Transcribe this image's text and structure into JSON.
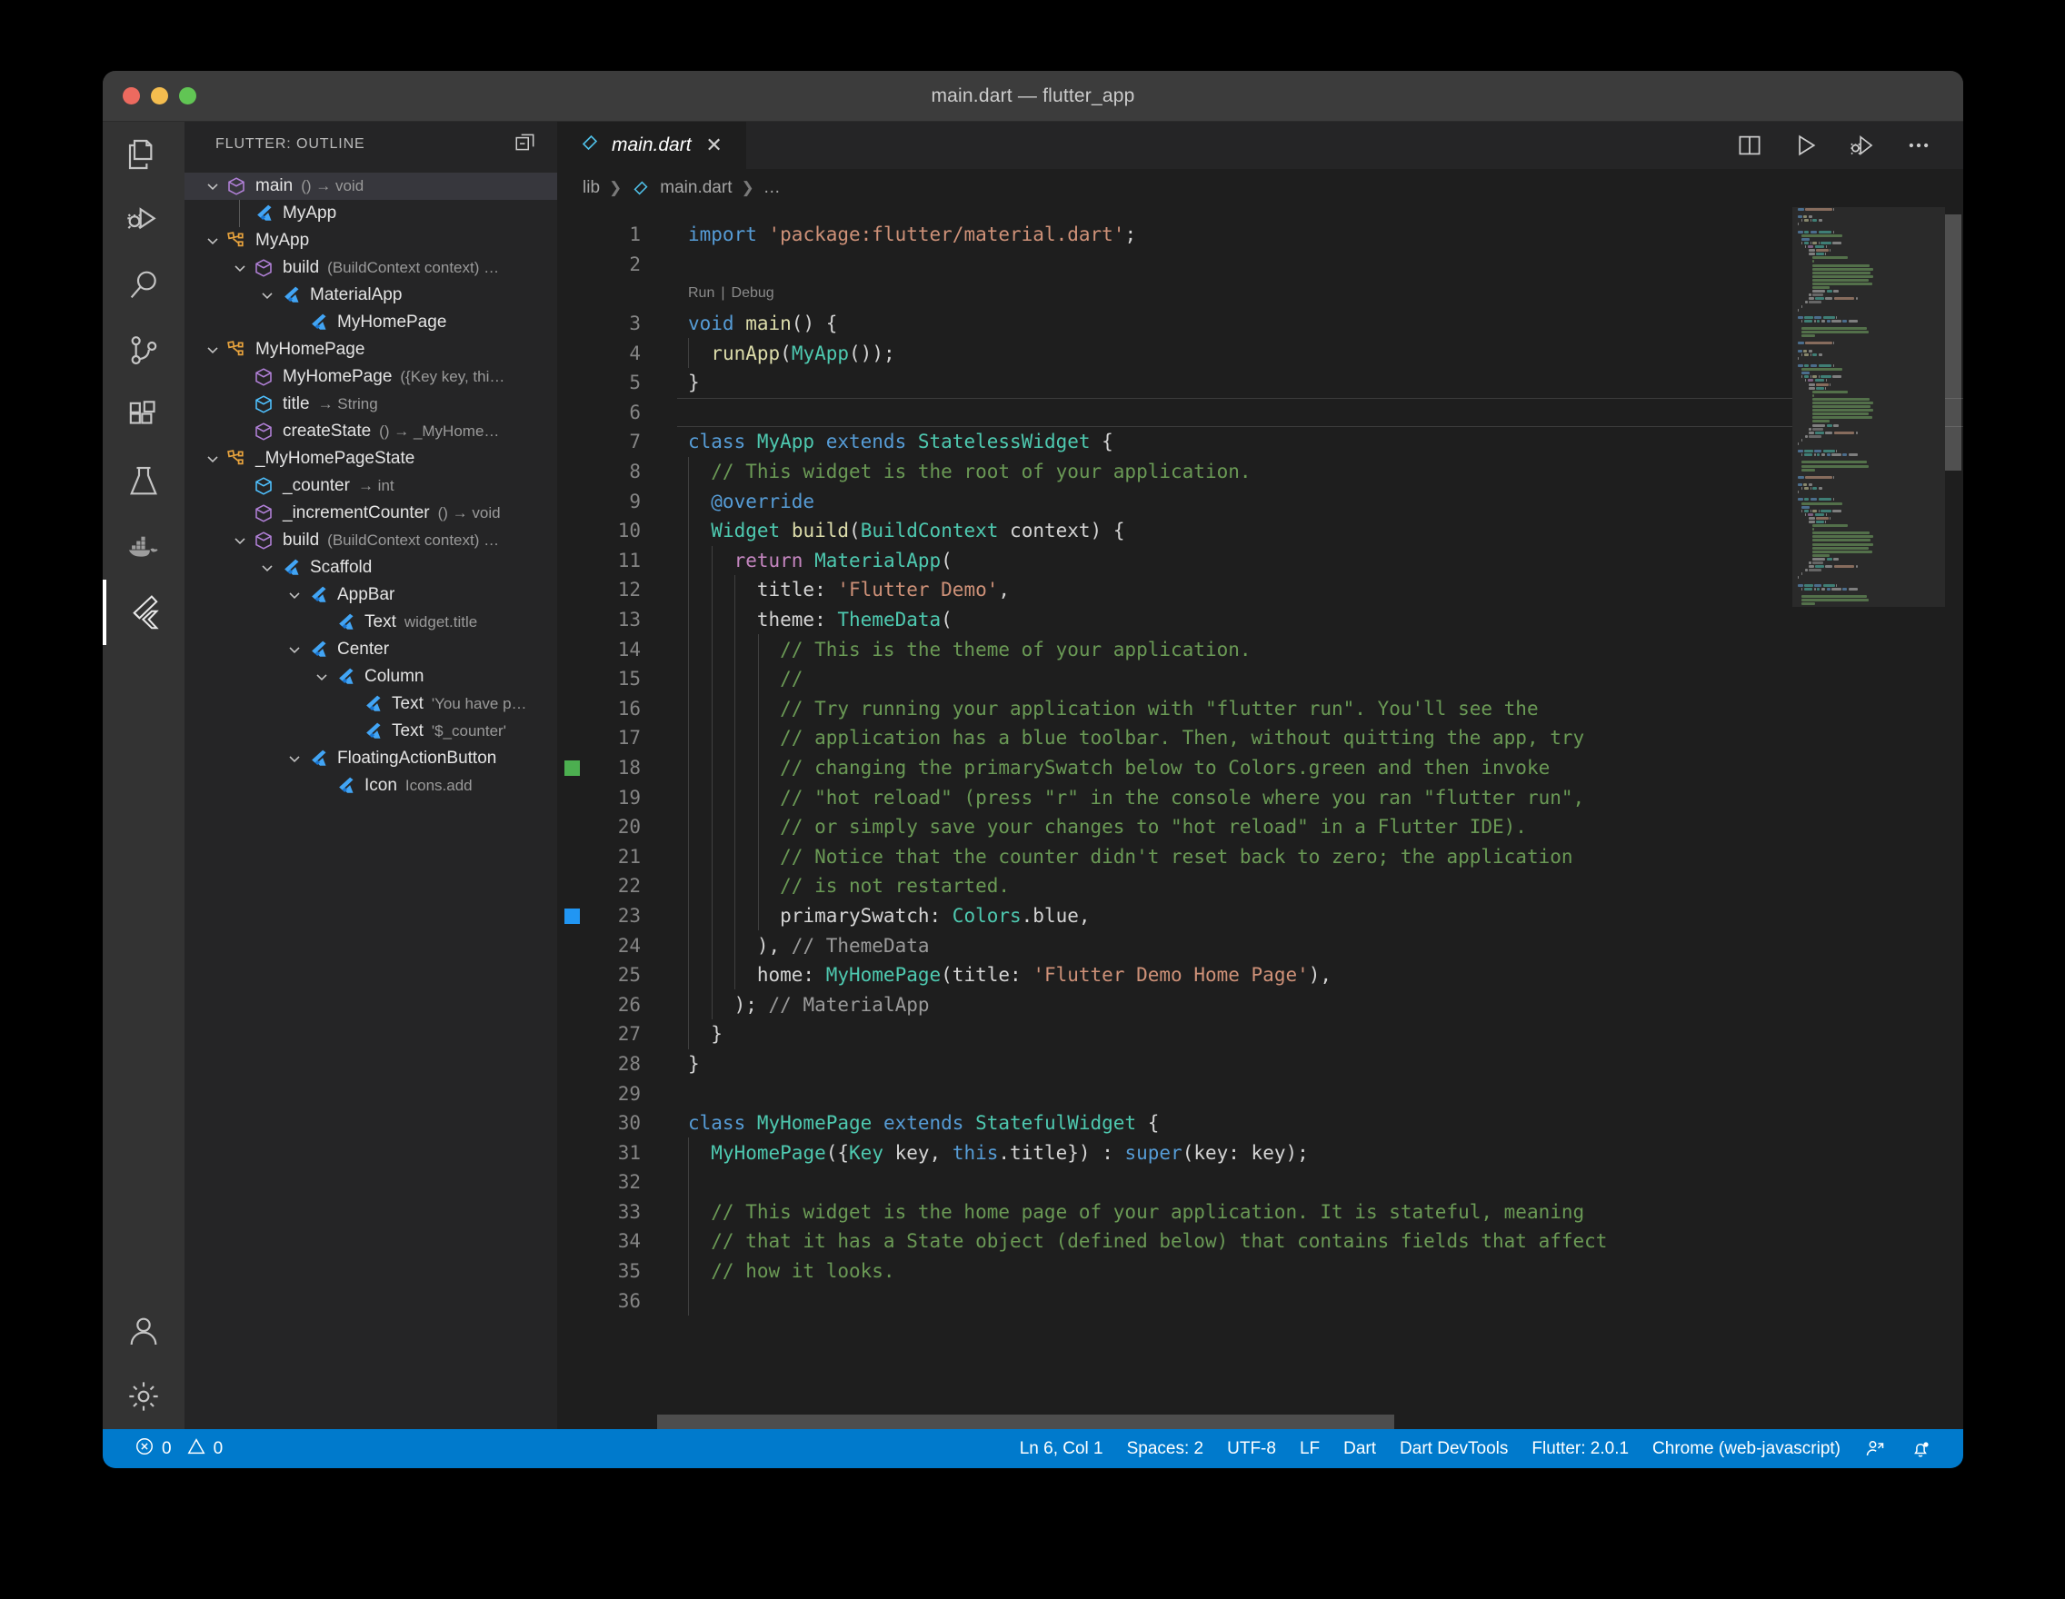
{
  "window": {
    "title": "main.dart — flutter_app",
    "traffic_lights": [
      "close",
      "minimize",
      "maximize"
    ]
  },
  "activity_bar": {
    "items": [
      {
        "name": "explorer",
        "icon": "files-icon",
        "active": false
      },
      {
        "name": "run-and-debug",
        "icon": "debug-play-icon",
        "active": false
      },
      {
        "name": "search",
        "icon": "search-icon",
        "active": false
      },
      {
        "name": "source-control",
        "icon": "source-control-icon",
        "active": false
      },
      {
        "name": "extensions",
        "icon": "extensions-icon",
        "active": false
      },
      {
        "name": "testing",
        "icon": "beaker-icon",
        "active": false
      },
      {
        "name": "docker",
        "icon": "docker-whale-icon",
        "active": false
      },
      {
        "name": "flutter",
        "icon": "flutter-icon",
        "active": true
      }
    ],
    "bottom_items": [
      {
        "name": "accounts",
        "icon": "account-icon"
      },
      {
        "name": "settings",
        "icon": "gear-icon"
      }
    ]
  },
  "sidebar": {
    "title": "FLUTTER: OUTLINE",
    "actions": [
      {
        "name": "collapse-all",
        "icon": "collapse-all-icon"
      }
    ],
    "tree": [
      {
        "indent": 0,
        "twist": "down",
        "icon": "method-cube",
        "label": "main",
        "detail": "() → void",
        "selected": true
      },
      {
        "indent": 1,
        "twist": "none",
        "icon": "flutter",
        "label": "MyApp",
        "detail": "",
        "selected": false
      },
      {
        "indent": 0,
        "twist": "down",
        "icon": "class-orange",
        "label": "MyApp",
        "detail": "",
        "selected": false
      },
      {
        "indent": 1,
        "twist": "down",
        "icon": "method-cube",
        "label": "build",
        "detail": "(BuildContext context) …",
        "selected": false
      },
      {
        "indent": 2,
        "twist": "down",
        "icon": "flutter",
        "label": "MaterialApp",
        "detail": "",
        "selected": false
      },
      {
        "indent": 3,
        "twist": "none",
        "icon": "flutter",
        "label": "MyHomePage",
        "detail": "",
        "selected": false
      },
      {
        "indent": 0,
        "twist": "down",
        "icon": "class-orange",
        "label": "MyHomePage",
        "detail": "",
        "selected": false
      },
      {
        "indent": 1,
        "twist": "none",
        "icon": "method-cube",
        "label": "MyHomePage",
        "detail": "({Key key, thi…",
        "selected": false
      },
      {
        "indent": 1,
        "twist": "none",
        "icon": "field-blue",
        "label": "title",
        "detail": "→ String",
        "selected": false
      },
      {
        "indent": 1,
        "twist": "none",
        "icon": "method-cube",
        "label": "createState",
        "detail": "() → _MyHome…",
        "selected": false
      },
      {
        "indent": 0,
        "twist": "down",
        "icon": "class-orange",
        "label": "_MyHomePageState",
        "detail": "",
        "selected": false
      },
      {
        "indent": 1,
        "twist": "none",
        "icon": "field-blue",
        "label": "_counter",
        "detail": "→ int",
        "selected": false
      },
      {
        "indent": 1,
        "twist": "none",
        "icon": "method-cube",
        "label": "_incrementCounter",
        "detail": "() → void",
        "selected": false
      },
      {
        "indent": 1,
        "twist": "down",
        "icon": "method-cube",
        "label": "build",
        "detail": "(BuildContext context) …",
        "selected": false
      },
      {
        "indent": 2,
        "twist": "down",
        "icon": "flutter",
        "label": "Scaffold",
        "detail": "",
        "selected": false
      },
      {
        "indent": 3,
        "twist": "down",
        "icon": "flutter",
        "label": "AppBar",
        "detail": "",
        "selected": false
      },
      {
        "indent": 4,
        "twist": "none",
        "icon": "flutter",
        "label": "Text",
        "detail": "widget.title",
        "selected": false
      },
      {
        "indent": 3,
        "twist": "down",
        "icon": "flutter",
        "label": "Center",
        "detail": "",
        "selected": false
      },
      {
        "indent": 4,
        "twist": "down",
        "icon": "flutter",
        "label": "Column",
        "detail": "",
        "selected": false
      },
      {
        "indent": 5,
        "twist": "none",
        "icon": "flutter",
        "label": "Text",
        "detail": "'You have p…",
        "selected": false
      },
      {
        "indent": 5,
        "twist": "none",
        "icon": "flutter",
        "label": "Text",
        "detail": "'$_counter'",
        "selected": false
      },
      {
        "indent": 3,
        "twist": "down",
        "icon": "flutter",
        "label": "FloatingActionButton",
        "detail": "",
        "selected": false
      },
      {
        "indent": 4,
        "twist": "none",
        "icon": "flutter",
        "label": "Icon",
        "detail": "Icons.add",
        "selected": false
      }
    ]
  },
  "editor": {
    "tab": {
      "label": "main.dart",
      "icon": "dart-icon",
      "close_label": "✕",
      "active": true
    },
    "toolbar": [
      {
        "name": "split-editor-right",
        "icon": "split-editor-icon"
      },
      {
        "name": "run-without-debugging",
        "icon": "play-icon"
      },
      {
        "name": "run-and-debug",
        "icon": "debug-play-icon"
      },
      {
        "name": "more-actions",
        "icon": "ellipsis-icon"
      }
    ],
    "breadcrumb": [
      "lib",
      "main.dart",
      "…"
    ],
    "codelens": {
      "line": 3,
      "items": [
        "Run",
        "Debug"
      ],
      "separator": "|"
    },
    "current_line": 6,
    "gutter_marks": [
      {
        "line": 18,
        "color": "#4caf50"
      },
      {
        "line": 23,
        "color": "#2196f3"
      }
    ],
    "first_line": 1,
    "last_line": 36,
    "lines": [
      {
        "n": 1,
        "indent": 0,
        "tokens": [
          {
            "t": "import ",
            "c": "kw"
          },
          {
            "t": "'package:flutter/material.dart'",
            "c": "str"
          },
          {
            "t": ";",
            "c": "pln"
          }
        ]
      },
      {
        "n": 2,
        "indent": 0,
        "tokens": []
      },
      {
        "n": 3,
        "indent": 0,
        "tokens": [
          {
            "t": "void ",
            "c": "kw"
          },
          {
            "t": "main",
            "c": "fn"
          },
          {
            "t": "() {",
            "c": "pln"
          }
        ]
      },
      {
        "n": 4,
        "indent": 1,
        "tokens": [
          {
            "t": "  ",
            "c": "pln"
          },
          {
            "t": "runApp",
            "c": "fn"
          },
          {
            "t": "(",
            "c": "pln"
          },
          {
            "t": "MyApp",
            "c": "typ"
          },
          {
            "t": "());",
            "c": "pln"
          }
        ]
      },
      {
        "n": 5,
        "indent": 0,
        "tokens": [
          {
            "t": "}",
            "c": "pln"
          }
        ]
      },
      {
        "n": 6,
        "indent": 0,
        "tokens": []
      },
      {
        "n": 7,
        "indent": 0,
        "tokens": [
          {
            "t": "class ",
            "c": "kw"
          },
          {
            "t": "MyApp",
            "c": "typ"
          },
          {
            "t": " extends ",
            "c": "kw"
          },
          {
            "t": "StatelessWidget",
            "c": "typ"
          },
          {
            "t": " {",
            "c": "pln"
          }
        ]
      },
      {
        "n": 8,
        "indent": 1,
        "tokens": [
          {
            "t": "  // This widget is the root of your application.",
            "c": "cmt"
          }
        ]
      },
      {
        "n": 9,
        "indent": 1,
        "tokens": [
          {
            "t": "  @override",
            "c": "anno"
          }
        ]
      },
      {
        "n": 10,
        "indent": 1,
        "tokens": [
          {
            "t": "  ",
            "c": "pln"
          },
          {
            "t": "Widget",
            "c": "typ"
          },
          {
            "t": " ",
            "c": "pln"
          },
          {
            "t": "build",
            "c": "fn"
          },
          {
            "t": "(",
            "c": "pln"
          },
          {
            "t": "BuildContext",
            "c": "typ"
          },
          {
            "t": " context) {",
            "c": "pln"
          }
        ]
      },
      {
        "n": 11,
        "indent": 2,
        "tokens": [
          {
            "t": "    ",
            "c": "pln"
          },
          {
            "t": "return ",
            "c": "kw2"
          },
          {
            "t": "MaterialApp",
            "c": "typ"
          },
          {
            "t": "(",
            "c": "pln"
          }
        ]
      },
      {
        "n": 12,
        "indent": 3,
        "tokens": [
          {
            "t": "      title: ",
            "c": "pln"
          },
          {
            "t": "'Flutter Demo'",
            "c": "str"
          },
          {
            "t": ",",
            "c": "pln"
          }
        ]
      },
      {
        "n": 13,
        "indent": 3,
        "tokens": [
          {
            "t": "      theme: ",
            "c": "pln"
          },
          {
            "t": "ThemeData",
            "c": "typ"
          },
          {
            "t": "(",
            "c": "pln"
          }
        ]
      },
      {
        "n": 14,
        "indent": 4,
        "tokens": [
          {
            "t": "        // This is the theme of your application.",
            "c": "cmt"
          }
        ]
      },
      {
        "n": 15,
        "indent": 4,
        "tokens": [
          {
            "t": "        //",
            "c": "cmt"
          }
        ]
      },
      {
        "n": 16,
        "indent": 4,
        "tokens": [
          {
            "t": "        // Try running your application with \"flutter run\". You'll see the",
            "c": "cmt"
          }
        ]
      },
      {
        "n": 17,
        "indent": 4,
        "tokens": [
          {
            "t": "        // application has a blue toolbar. Then, without quitting the app, try",
            "c": "cmt"
          }
        ]
      },
      {
        "n": 18,
        "indent": 4,
        "tokens": [
          {
            "t": "        // changing the primarySwatch below to Colors.green and then invoke",
            "c": "cmt"
          }
        ]
      },
      {
        "n": 19,
        "indent": 4,
        "tokens": [
          {
            "t": "        // \"hot reload\" (press \"r\" in the console where you ran \"flutter run\",",
            "c": "cmt"
          }
        ]
      },
      {
        "n": 20,
        "indent": 4,
        "tokens": [
          {
            "t": "        // or simply save your changes to \"hot reload\" in a Flutter IDE).",
            "c": "cmt"
          }
        ]
      },
      {
        "n": 21,
        "indent": 4,
        "tokens": [
          {
            "t": "        // Notice that the counter didn't reset back to zero; the application",
            "c": "cmt"
          }
        ]
      },
      {
        "n": 22,
        "indent": 4,
        "tokens": [
          {
            "t": "        // is not restarted.",
            "c": "cmt"
          }
        ]
      },
      {
        "n": 23,
        "indent": 4,
        "tokens": [
          {
            "t": "        primarySwatch: ",
            "c": "pln"
          },
          {
            "t": "Colors",
            "c": "typ"
          },
          {
            "t": ".blue,",
            "c": "pln"
          }
        ]
      },
      {
        "n": 24,
        "indent": 3,
        "tokens": [
          {
            "t": "      ), ",
            "c": "pln"
          },
          {
            "t": "// ThemeData",
            "c": "cmtg"
          }
        ]
      },
      {
        "n": 25,
        "indent": 3,
        "tokens": [
          {
            "t": "      home: ",
            "c": "pln"
          },
          {
            "t": "MyHomePage",
            "c": "typ"
          },
          {
            "t": "(title: ",
            "c": "pln"
          },
          {
            "t": "'Flutter Demo Home Page'",
            "c": "str"
          },
          {
            "t": "),",
            "c": "pln"
          }
        ]
      },
      {
        "n": 26,
        "indent": 2,
        "tokens": [
          {
            "t": "    ); ",
            "c": "pln"
          },
          {
            "t": "// MaterialApp",
            "c": "cmtg"
          }
        ]
      },
      {
        "n": 27,
        "indent": 1,
        "tokens": [
          {
            "t": "  }",
            "c": "pln"
          }
        ]
      },
      {
        "n": 28,
        "indent": 0,
        "tokens": [
          {
            "t": "}",
            "c": "pln"
          }
        ]
      },
      {
        "n": 29,
        "indent": 0,
        "tokens": []
      },
      {
        "n": 30,
        "indent": 0,
        "tokens": [
          {
            "t": "class ",
            "c": "kw"
          },
          {
            "t": "MyHomePage",
            "c": "typ"
          },
          {
            "t": " extends ",
            "c": "kw"
          },
          {
            "t": "StatefulWidget",
            "c": "typ"
          },
          {
            "t": " {",
            "c": "pln"
          }
        ]
      },
      {
        "n": 31,
        "indent": 1,
        "tokens": [
          {
            "t": "  ",
            "c": "pln"
          },
          {
            "t": "MyHomePage",
            "c": "typ"
          },
          {
            "t": "({",
            "c": "pln"
          },
          {
            "t": "Key",
            "c": "typ"
          },
          {
            "t": " key, ",
            "c": "pln"
          },
          {
            "t": "this",
            "c": "kw"
          },
          {
            "t": ".title}) : ",
            "c": "pln"
          },
          {
            "t": "super",
            "c": "kw"
          },
          {
            "t": "(key: key);",
            "c": "pln"
          }
        ]
      },
      {
        "n": 32,
        "indent": 1,
        "tokens": []
      },
      {
        "n": 33,
        "indent": 1,
        "tokens": [
          {
            "t": "  // This widget is the home page of your application. It is stateful, meaning",
            "c": "cmt"
          }
        ]
      },
      {
        "n": 34,
        "indent": 1,
        "tokens": [
          {
            "t": "  // that it has a State object (defined below) that contains fields that affect",
            "c": "cmt"
          }
        ]
      },
      {
        "n": 35,
        "indent": 1,
        "tokens": [
          {
            "t": "  // how it looks.",
            "c": "cmt"
          }
        ]
      },
      {
        "n": 36,
        "indent": 1,
        "tokens": []
      }
    ]
  },
  "status_bar": {
    "left": [
      {
        "name": "problems",
        "icon": "error-icon",
        "errors": "0",
        "warn_icon": "warning-icon",
        "warnings": "0"
      }
    ],
    "right": [
      {
        "name": "editor-position",
        "label": "Ln 6, Col 1"
      },
      {
        "name": "indentation",
        "label": "Spaces: 2"
      },
      {
        "name": "encoding",
        "label": "UTF-8"
      },
      {
        "name": "eol",
        "label": "LF"
      },
      {
        "name": "language-mode",
        "label": "Dart"
      },
      {
        "name": "dart-devtools",
        "label": "Dart DevTools"
      },
      {
        "name": "flutter-version",
        "label": "Flutter: 2.0.1"
      },
      {
        "name": "device-selector",
        "label": "Chrome (web-javascript)"
      },
      {
        "name": "live-share",
        "label": "",
        "icon": "live-share-icon"
      },
      {
        "name": "notifications",
        "label": "",
        "icon": "bell-dot-icon"
      }
    ]
  },
  "colors": {
    "accent": "#007acc",
    "titlebar": "#3c3c3c",
    "activitybar": "#333333",
    "sidebar": "#252526",
    "editor": "#1e1e1e",
    "selection": "#37373d",
    "git_added": "#4caf50",
    "git_modified": "#2196f3",
    "flutter_blue": "#42a5f5",
    "class_orange": "#e8a33d",
    "method_purple": "#b180d7",
    "field_blue": "#4fc1ff"
  }
}
